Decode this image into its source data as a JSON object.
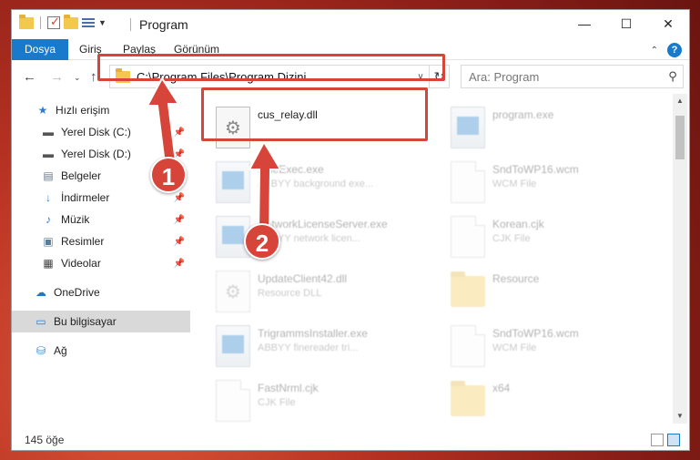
{
  "window": {
    "title": "Program",
    "controls": {
      "minimize": "—",
      "maximize": "☐",
      "close": "✕"
    }
  },
  "ribbon": {
    "tabs": [
      {
        "label": "Dosya",
        "active": true
      },
      {
        "label": "Giriş",
        "active": false
      },
      {
        "label": "Paylaş",
        "active": false
      },
      {
        "label": "Görünüm",
        "active": false
      }
    ],
    "help": "?"
  },
  "nav": {
    "address": "C:\\Program Files\\Program Dizini",
    "search_placeholder": "Ara: Program"
  },
  "sidebar": {
    "items": [
      {
        "label": "Hızlı erişim",
        "icon": "star-icon",
        "pinned": false,
        "selected": false,
        "indent": 0
      },
      {
        "label": "Yerel Disk (C:)",
        "icon": "drive-icon",
        "pinned": true,
        "selected": false,
        "indent": 1
      },
      {
        "label": "Yerel Disk (D:)",
        "icon": "drive-icon",
        "pinned": true,
        "selected": false,
        "indent": 1
      },
      {
        "label": "Belgeler",
        "icon": "documents-icon",
        "pinned": true,
        "selected": false,
        "indent": 1
      },
      {
        "label": "İndirmeler",
        "icon": "download-icon",
        "pinned": true,
        "selected": false,
        "indent": 1
      },
      {
        "label": "Müzik",
        "icon": "music-icon",
        "pinned": true,
        "selected": false,
        "indent": 1
      },
      {
        "label": "Resimler",
        "icon": "pictures-icon",
        "pinned": true,
        "selected": false,
        "indent": 1
      },
      {
        "label": "Videolar",
        "icon": "videos-icon",
        "pinned": true,
        "selected": false,
        "indent": 1
      },
      {
        "label": "OneDrive",
        "icon": "cloud-icon",
        "pinned": false,
        "selected": false,
        "indent": 0
      },
      {
        "label": "Bu bilgisayar",
        "icon": "computer-icon",
        "pinned": false,
        "selected": true,
        "indent": 0
      },
      {
        "label": "Ağ",
        "icon": "network-icon",
        "pinned": false,
        "selected": false,
        "indent": 0
      }
    ]
  },
  "files": [
    {
      "name": "cus_relay.dll",
      "sub": "",
      "kind": "gear",
      "faded": false
    },
    {
      "name": "program.exe",
      "sub": "",
      "kind": "exe",
      "faded": true
    },
    {
      "name": "FineExec.exe",
      "sub": "ABBYY background exe...",
      "kind": "exe",
      "faded": true
    },
    {
      "name": "SndToWP16.wcm",
      "sub": "WCM File",
      "kind": "doc",
      "faded": true
    },
    {
      "name": "NetworkLicenseServer.exe",
      "sub": "ABBYY network licen...",
      "kind": "exe",
      "faded": true
    },
    {
      "name": "Korean.cjk",
      "sub": "CJK File",
      "kind": "doc",
      "faded": true
    },
    {
      "name": "UpdateClient42.dll",
      "sub": "Resource DLL",
      "kind": "gear",
      "faded": true
    },
    {
      "name": "Resource",
      "sub": "",
      "kind": "fold",
      "faded": true
    },
    {
      "name": "TrigrammsInstaller.exe",
      "sub": "ABBYY finereader tri...",
      "kind": "exe",
      "faded": true
    },
    {
      "name": "SndToWP16.wcm",
      "sub": "WCM File",
      "kind": "doc",
      "faded": true
    },
    {
      "name": "FastNrml.cjk",
      "sub": "CJK File",
      "kind": "doc",
      "faded": true
    },
    {
      "name": "x64",
      "sub": "",
      "kind": "fold",
      "faded": true
    }
  ],
  "status": {
    "count": "145 öğe"
  },
  "callouts": [
    {
      "number": "1"
    },
    {
      "number": "2"
    }
  ],
  "colors": {
    "accent": "#1979ca",
    "callout": "#d6443a"
  }
}
